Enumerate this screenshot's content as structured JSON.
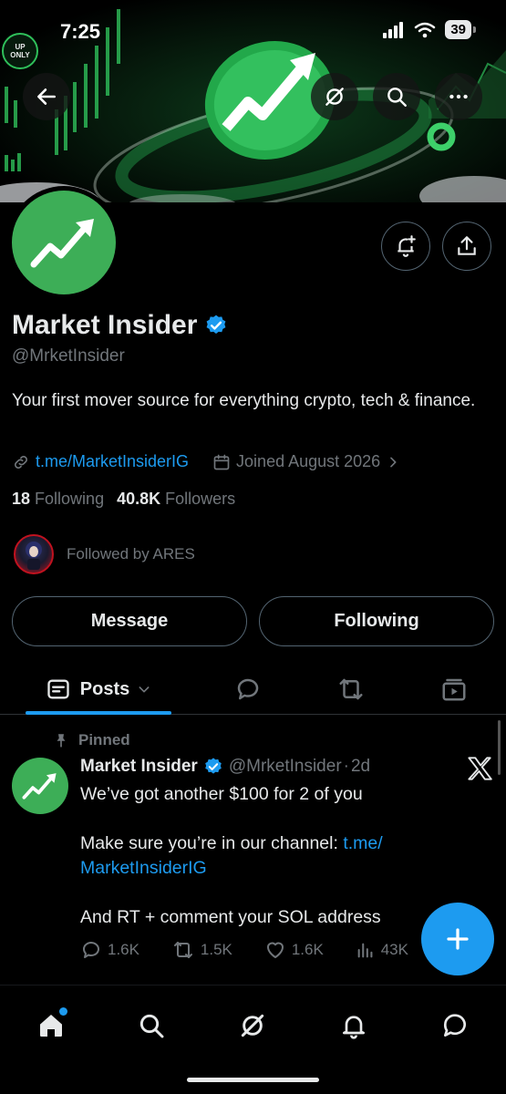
{
  "status_bar": {
    "time": "7:25",
    "battery": "39"
  },
  "banner": {
    "badge_text": "UP ONLY"
  },
  "profile": {
    "name": "Market Insider",
    "handle": "@MrketInsider",
    "bio": "Your first mover source for everything crypto, tech & finance.",
    "link": "t.me/MarketInsiderIG",
    "joined": "Joined August 2026",
    "following_count": "18",
    "following_label": "Following",
    "followers_count": "40.8K",
    "followers_label": "Followers",
    "followed_by": "Followed by ARES"
  },
  "buttons": {
    "message": "Message",
    "following": "Following"
  },
  "tabs": {
    "posts_label": "Posts"
  },
  "post": {
    "pinned_label": "Pinned",
    "author_name": "Market Insider",
    "author_handle": "@MrketInsider",
    "dot": "·",
    "time": "2d",
    "line1": "We’ve got another $100 for 2 of you",
    "line2_prefix": "Make sure you’re in our channel: ",
    "line2_link_a": "t.me/",
    "line2_link_b": "MarketInsiderIG",
    "line3": "And RT + comment your SOL address",
    "replies": "1.6K",
    "reposts": "1.5K",
    "likes": "1.6K",
    "views": "43K"
  },
  "colors": {
    "accent": "#1d9bf0",
    "brand_green": "#3dae57",
    "verified": "#1d9bf0"
  },
  "icons": [
    "back-arrow-icon",
    "grok-icon",
    "search-icon",
    "more-icon",
    "bell-plus-icon",
    "share-icon",
    "verified-icon",
    "link-icon",
    "calendar-icon",
    "chevron-right-icon",
    "posts-icon",
    "chevron-down-icon",
    "replies-icon",
    "highlights-icon",
    "media-icon",
    "pin-icon",
    "x-logo-icon",
    "reply-icon",
    "repost-icon",
    "like-icon",
    "views-icon",
    "plus-icon",
    "home-icon",
    "explore-icon",
    "grok-nav-icon",
    "notifications-icon",
    "messages-icon"
  ]
}
